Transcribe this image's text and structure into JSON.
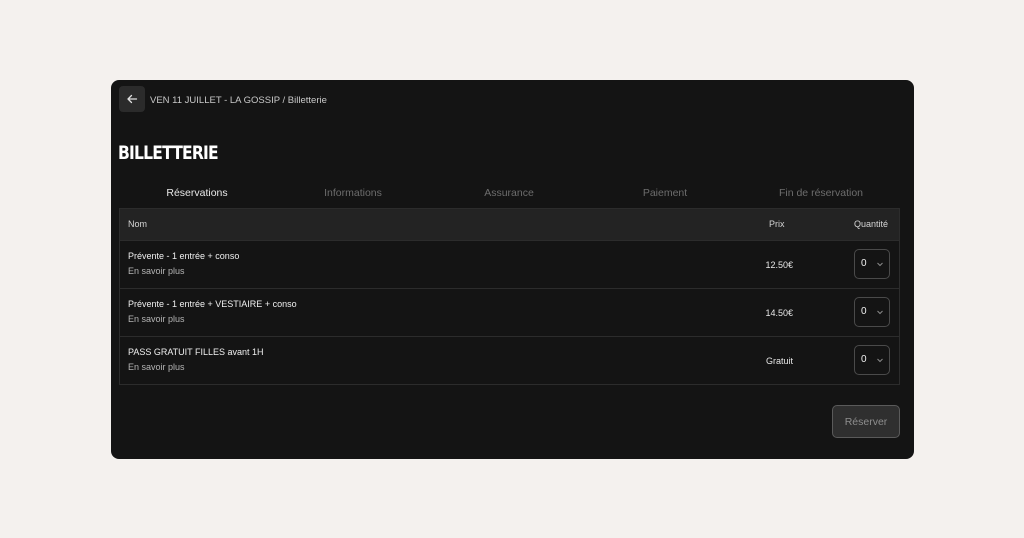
{
  "breadcrumb": "VEN 11 JUILLET - LA GOSSIP / Billetterie",
  "title": "BILLETTERIE",
  "tabs": [
    {
      "label": "Réservations"
    },
    {
      "label": "Informations"
    },
    {
      "label": "Assurance"
    },
    {
      "label": "Paiement"
    },
    {
      "label": "Fin de réservation"
    }
  ],
  "table": {
    "headers": {
      "name": "Nom",
      "price": "Prix",
      "quantity": "Quantité"
    },
    "rows": [
      {
        "name": "Prévente - 1 entrée + conso",
        "more": "En savoir plus",
        "price": "12.50€",
        "quantity": "0"
      },
      {
        "name": "Prévente - 1 entrée + VESTIAIRE + conso",
        "more": "En savoir plus",
        "price": "14.50€",
        "quantity": "0"
      },
      {
        "name": "PASS GRATUIT FILLES avant 1H",
        "more": "En savoir plus",
        "price": "Gratuit",
        "quantity": "0"
      }
    ]
  },
  "reserve_label": "Réserver",
  "colors": {
    "page_bg": "#f4f1ee",
    "card_bg": "#141414",
    "header_bg": "#232323"
  },
  "icons": {
    "back": "arrow-left-icon",
    "select": "chevron-down-icon"
  }
}
